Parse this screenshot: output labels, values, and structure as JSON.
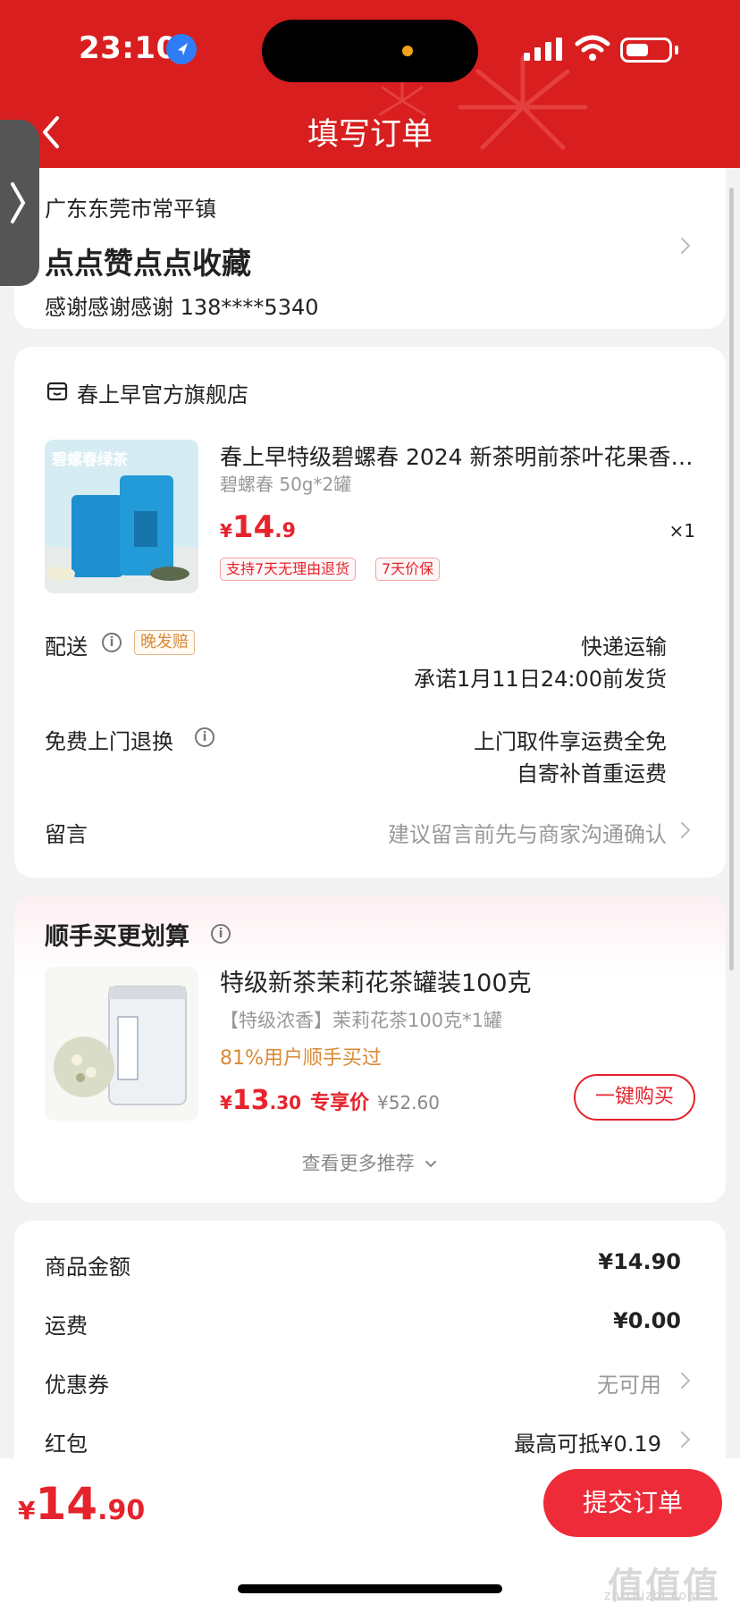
{
  "status_bar": {
    "time": "23:10"
  },
  "header": {
    "title": "填写订单"
  },
  "address": {
    "region": "广东东莞市常平镇",
    "name": "点点赞点点收藏",
    "contact": "感谢感谢感谢  138****5340"
  },
  "store": {
    "name": "春上早官方旗舰店",
    "product": {
      "title": "春上早特级碧螺春 2024 新茶明前茶叶花果香…",
      "spec": "碧螺春 50g*2罐",
      "price_yen": "¥",
      "price_int": "14",
      "price_dec": ".9",
      "qty": "×1",
      "tags": [
        "支持7天无理由退货",
        "7天价保"
      ],
      "image_label": "碧螺春绿茶"
    },
    "shipping": {
      "label": "配送",
      "badge": "晚发赔",
      "method": "快递运输",
      "promise": "承诺1月11日24:00前发货"
    },
    "returns": {
      "label": "免费上门退换",
      "line1": "上门取件享运费全免",
      "line2": "自寄补首重运费"
    },
    "message": {
      "label": "留言",
      "placeholder": "建议留言前先与商家沟通确认"
    }
  },
  "upsell": {
    "title": "顺手买更划算",
    "name": "特级新茶茉莉花茶罐装100克",
    "spec": "【特级浓香】茉莉花茶100克*1罐",
    "percent": "81%用户顺手买过",
    "price_yen": "¥",
    "price_int": "13",
    "price_dec": ".30",
    "price_tag": "专享价",
    "original_price": "¥52.60",
    "buy_label": "一键购买",
    "more_label": "查看更多推荐"
  },
  "fees": [
    {
      "label": "商品金额",
      "value": "¥14.90"
    },
    {
      "label": "运费",
      "value": "¥0.00"
    },
    {
      "label": "优惠券",
      "value": "无可用"
    },
    {
      "label": "红包",
      "value": "最高可抵¥0.19"
    }
  ],
  "bottom": {
    "total_yen": "¥",
    "total_int": "14",
    "total_dec": ".90",
    "submit_label": "提交订单",
    "watermark": "值值值",
    "watermark_sub": "zhizhizhi.com"
  },
  "colors": {
    "brand_red": "#d81e1e",
    "price_red": "#e6232c",
    "accent_orange": "#d98a35"
  },
  "icons": [
    "location-arrow-icon",
    "signal-icon",
    "wifi-icon",
    "battery-icon",
    "back-chevron-icon",
    "store-icon",
    "info-icon",
    "chevron-right-icon",
    "chevron-down-icon"
  ]
}
